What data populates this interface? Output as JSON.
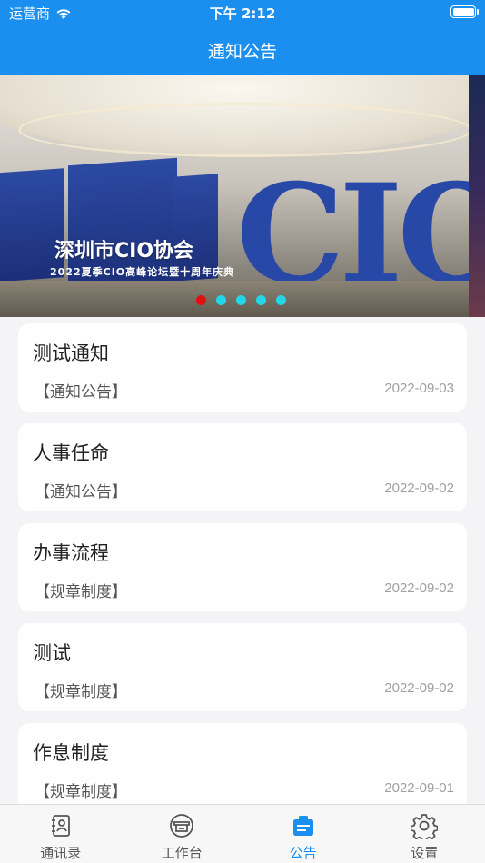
{
  "status_bar": {
    "carrier": "运营商",
    "time": "下午 2:12"
  },
  "nav": {
    "title": "通知公告"
  },
  "banner": {
    "caption": "深圳市CIO协会",
    "subcaption": "2022夏季CIO高峰论坛暨十周年庆典",
    "dot_colors": [
      "#e01010",
      "#22d8e8",
      "#22d8e8",
      "#22d8e8",
      "#22d8e8"
    ],
    "active_dot": 0
  },
  "notices": [
    {
      "title": "测试通知",
      "category": "【通知公告】",
      "date": "2022-09-03"
    },
    {
      "title": "人事任命",
      "category": "【通知公告】",
      "date": "2022-09-02"
    },
    {
      "title": "办事流程",
      "category": "【规章制度】",
      "date": "2022-09-02"
    },
    {
      "title": "测试",
      "category": "【规章制度】",
      "date": "2022-09-02"
    },
    {
      "title": "作息制度",
      "category": "【规章制度】",
      "date": "2022-09-01"
    }
  ],
  "tabbar": {
    "items": [
      {
        "label": "通讯录",
        "icon": "contacts-icon",
        "active": false
      },
      {
        "label": "工作台",
        "icon": "workbench-icon",
        "active": false
      },
      {
        "label": "公告",
        "icon": "announcement-icon",
        "active": true
      },
      {
        "label": "设置",
        "icon": "settings-icon",
        "active": false
      }
    ]
  },
  "colors": {
    "primary": "#1a8ff0",
    "background": "#f4f4f6"
  }
}
